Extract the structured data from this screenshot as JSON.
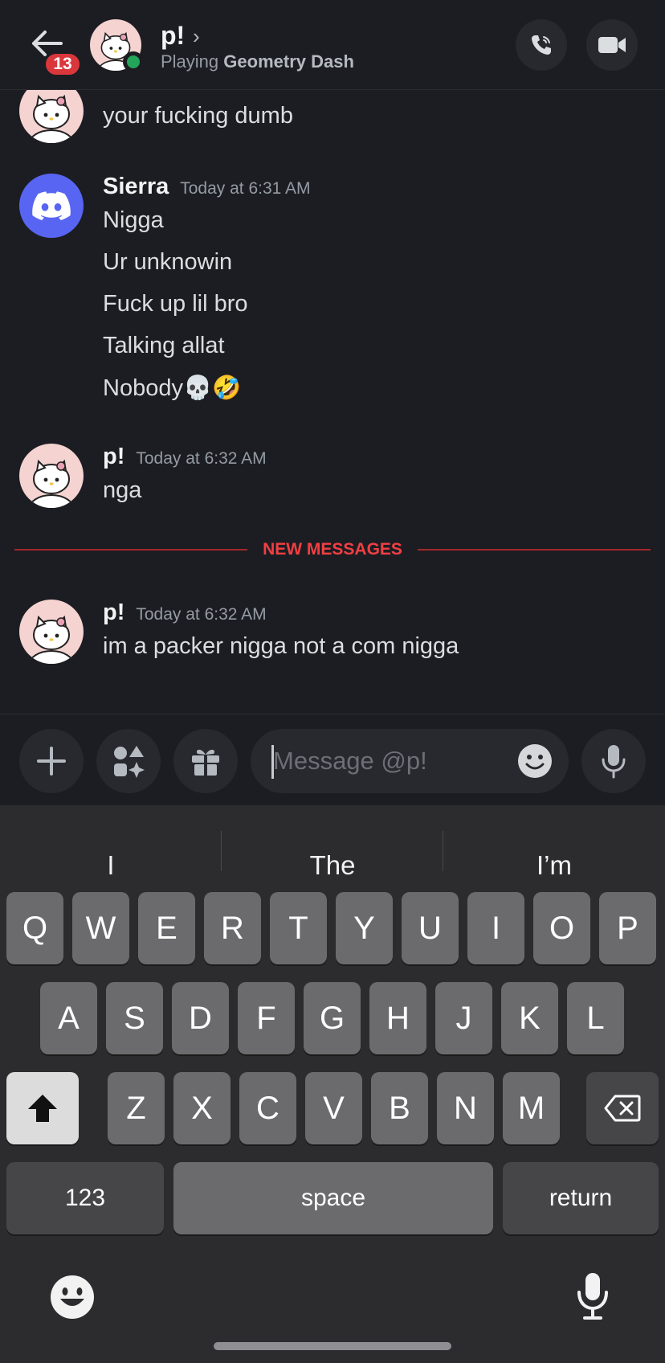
{
  "header": {
    "badge_count": "13",
    "name": "p!",
    "chevron": "›",
    "status_prefix": "Playing",
    "status_game": "Geometry Dash"
  },
  "messages": {
    "partial_text": "your fucking dumb",
    "sierra": {
      "author": "Sierra",
      "time": "Today at 6:31 AM",
      "lines": [
        "Nigga",
        "Ur unknowin",
        "Fuck up lil bro",
        "Talking allat",
        "Nobody💀🤣"
      ]
    },
    "p1": {
      "author": "p!",
      "time": "Today at 6:32 AM",
      "text": "nga"
    },
    "divider_label": "NEW MESSAGES",
    "p2": {
      "author": "p!",
      "time": "Today at 6:32 AM",
      "text": "im a packer nigga not a com nigga"
    }
  },
  "composer": {
    "placeholder": "Message @p!"
  },
  "keyboard": {
    "suggestions": [
      "I",
      "The",
      "I’m"
    ],
    "row1": [
      "Q",
      "W",
      "E",
      "R",
      "T",
      "Y",
      "U",
      "I",
      "O",
      "P"
    ],
    "row2": [
      "A",
      "S",
      "D",
      "F",
      "G",
      "H",
      "J",
      "K",
      "L"
    ],
    "row3": [
      "Z",
      "X",
      "C",
      "V",
      "B",
      "N",
      "M"
    ],
    "numbers_label": "123",
    "space_label": "space",
    "return_label": "return"
  },
  "colors": {
    "background": "#1c1d22",
    "accent_blurple": "#5865f2",
    "online_green": "#23a55a",
    "danger_red": "#da373c"
  }
}
